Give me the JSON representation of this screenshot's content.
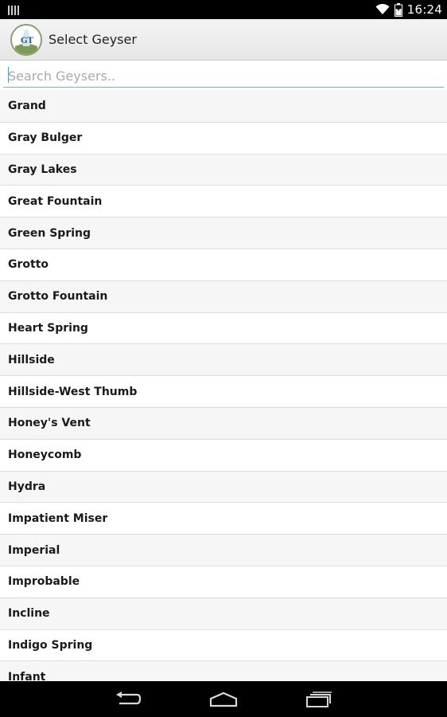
{
  "status_bar": {
    "time": "16:24",
    "icons": [
      "signal-bars-icon",
      "wifi-icon",
      "battery-icon"
    ]
  },
  "action_bar": {
    "logo_text": "GT",
    "title": "Select Geyser"
  },
  "search": {
    "placeholder": "Search Geysers..",
    "value": ""
  },
  "geysers": [
    "Grand",
    "Gray Bulger",
    "Gray Lakes",
    "Great Fountain",
    "Green Spring",
    "Grotto",
    "Grotto Fountain",
    "Heart Spring",
    "Hillside",
    "Hillside-West Thumb",
    "Honey's Vent",
    "Honeycomb",
    "Hydra",
    "Impatient Miser",
    "Imperial",
    "Improbable",
    "Incline",
    "Indigo Spring",
    "Infant"
  ],
  "nav_bar": {
    "icons": [
      "back-icon",
      "home-icon",
      "recent-apps-icon"
    ]
  },
  "colors": {
    "search_underline": "#6fb8dc",
    "action_bar": "#ececec",
    "row_alt": "#f6f6f6"
  }
}
